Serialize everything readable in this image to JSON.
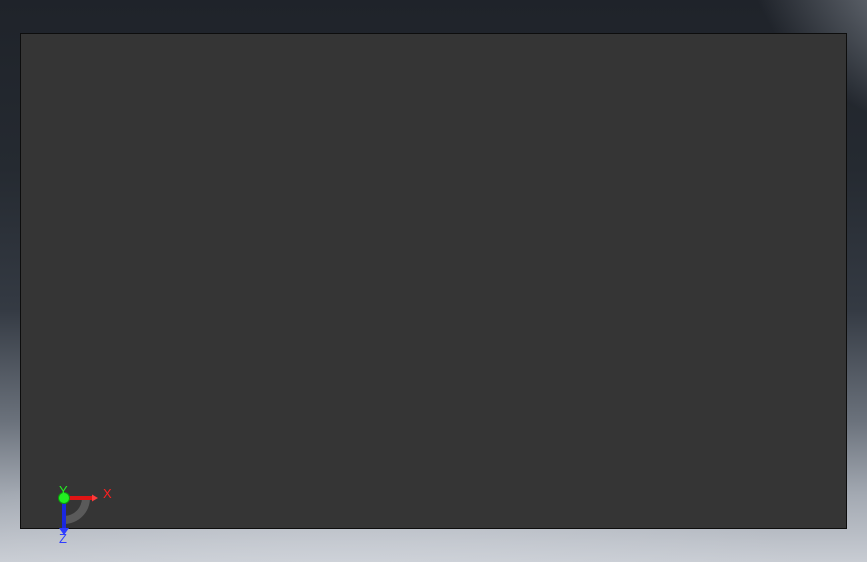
{
  "viewport": {
    "background_top": "#1f232a",
    "background_bottom": "#c8ccd3",
    "plane_color": "#353535"
  },
  "triad": {
    "x_label": "X",
    "y_label": "Y",
    "z_label": "Z",
    "x_color": "#ff1a1a",
    "y_color": "#22ee22",
    "z_color": "#1f2fff"
  }
}
